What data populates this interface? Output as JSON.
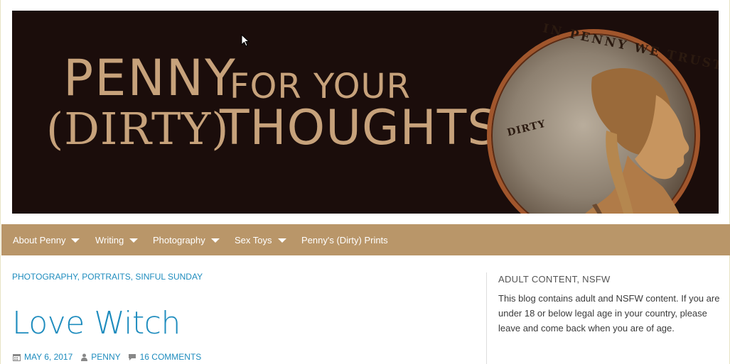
{
  "banner": {
    "title_line1_a": "PENNY",
    "title_line1_b": "FOR YOUR",
    "title_line2_a": "(DIRTY)",
    "title_line2_b": "THOUGHTS",
    "coin_motto": "IN PENNY WE TRUST",
    "coin_stamp": "DIRTY"
  },
  "nav": {
    "items": [
      {
        "label": "About Penny"
      },
      {
        "label": "Writing"
      },
      {
        "label": "Photography"
      },
      {
        "label": "Sex Toys"
      },
      {
        "label": "Penny's (Dirty) Prints"
      }
    ]
  },
  "post": {
    "categories": [
      "PHOTOGRAPHY",
      "PORTRAITS",
      "SINFUL SUNDAY"
    ],
    "title": "Love Witch",
    "date": "MAY 6, 2017",
    "author": "PENNY",
    "comments": "16 COMMENTS"
  },
  "sidebar": {
    "widget_title": "ADULT CONTENT, NSFW",
    "widget_text": "This blog contains adult and NSFW content. If you are under 18 or below legal age in your country, please leave and come back when you are of age."
  },
  "colors": {
    "nav_bg": "#b99669",
    "link": "#1e8cbe",
    "banner_bg": "#1b0d0b",
    "banner_text": "#c7a27b"
  }
}
